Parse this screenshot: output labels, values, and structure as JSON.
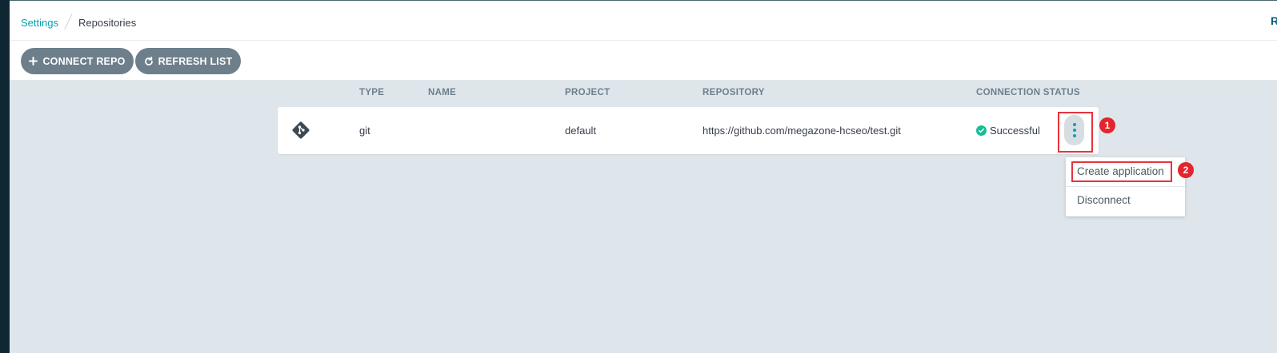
{
  "breadcrumb": {
    "parent": "Settings",
    "current": "Repositories"
  },
  "header_right": "R",
  "toolbar": {
    "connect_label": "CONNECT REPO",
    "refresh_label": "REFRESH LIST"
  },
  "columns": {
    "type": "TYPE",
    "name": "NAME",
    "project": "PROJECT",
    "repository": "REPOSITORY",
    "status": "CONNECTION STATUS"
  },
  "repos": [
    {
      "icon": "git-icon",
      "type": "git",
      "name": "",
      "project": "default",
      "repository": "https://github.com/megazone-hcseo/test.git",
      "status": "Successful",
      "status_color": "#18be94"
    }
  ],
  "menu": {
    "create": "Create application",
    "disconnect": "Disconnect"
  },
  "annotations": {
    "marker1": "1",
    "marker2": "2"
  },
  "colors": {
    "accent": "#00a2b3",
    "button": "#6d7f8b",
    "highlight": "#e8333d",
    "sidebar": "#0f2733"
  }
}
